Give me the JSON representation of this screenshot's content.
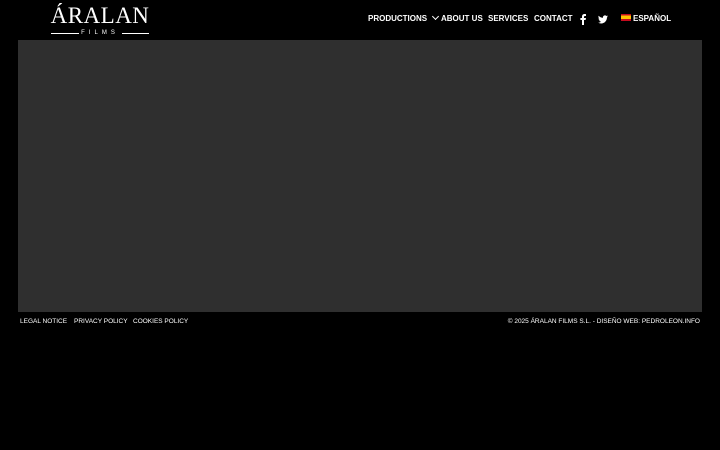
{
  "logo": {
    "main": "ÁRALAN",
    "sub": "FILMS"
  },
  "nav": {
    "items": [
      {
        "label": "PRODUCTIONS",
        "has_dropdown": true
      },
      {
        "label": "ABOUT US"
      },
      {
        "label": "SERVICES"
      },
      {
        "label": "CONTACT"
      }
    ],
    "social": [
      {
        "icon": "facebook-icon"
      },
      {
        "icon": "twitter-icon"
      }
    ],
    "language": {
      "label": "ESPAÑOL",
      "icon": "spain-flag-icon"
    }
  },
  "hero": {
    "background": "#2f2f2f"
  },
  "footer": {
    "links": [
      "LEGAL NOTICE",
      "PRIVACY POLICY",
      "COOKIES POLICY"
    ],
    "copyright": "© 2025 ÁRALAN FILMS S.L. - DISEÑO WEB: PEDROLEON.INFO"
  },
  "colors": {
    "background": "#000000",
    "panel": "#2f2f2f",
    "text": "#ffffff"
  }
}
